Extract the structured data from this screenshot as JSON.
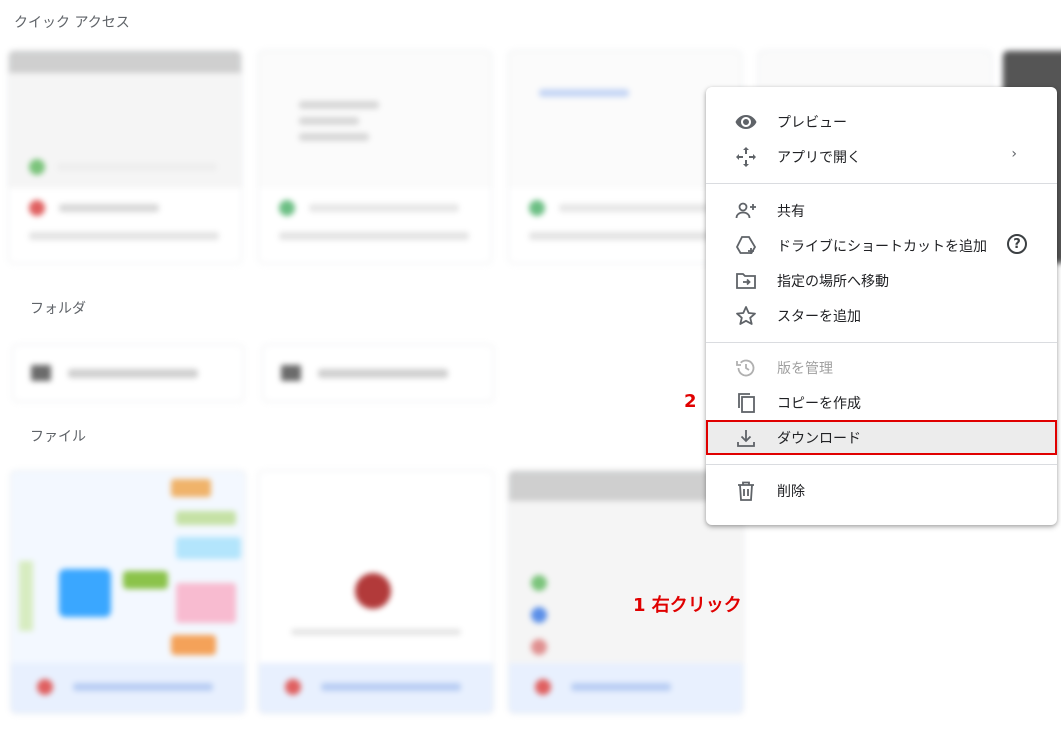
{
  "sections": {
    "quick_access": "クイック アクセス",
    "folders": "フォルダ",
    "files": "ファイル"
  },
  "context_menu": {
    "items": [
      {
        "label": "プレビュー",
        "icon": "eye-icon",
        "enabled": true
      },
      {
        "label": "アプリで開く",
        "icon": "move-arrows-icon",
        "enabled": true,
        "submenu": "›"
      },
      {
        "label": "共有",
        "icon": "add-person-icon",
        "enabled": true
      },
      {
        "label": "ドライブにショートカットを追加",
        "icon": "drive-shortcut-icon",
        "enabled": true,
        "help": "?"
      },
      {
        "label": "指定の場所へ移動",
        "icon": "folder-move-icon",
        "enabled": true
      },
      {
        "label": "スターを追加",
        "icon": "star-icon",
        "enabled": true
      },
      {
        "label": "版を管理",
        "icon": "history-icon",
        "enabled": false
      },
      {
        "label": "コピーを作成",
        "icon": "copy-icon",
        "enabled": true
      },
      {
        "label": "ダウンロード",
        "icon": "download-icon",
        "enabled": true,
        "highlighted": true
      },
      {
        "label": "削除",
        "icon": "trash-icon",
        "enabled": true
      }
    ]
  },
  "annotations": {
    "step1": "1 右クリック",
    "step2": "2"
  },
  "colors": {
    "annotation": "#e00000",
    "menu_text": "#202124",
    "disabled_text": "#a0a0a0",
    "separator": "#dadce0"
  }
}
